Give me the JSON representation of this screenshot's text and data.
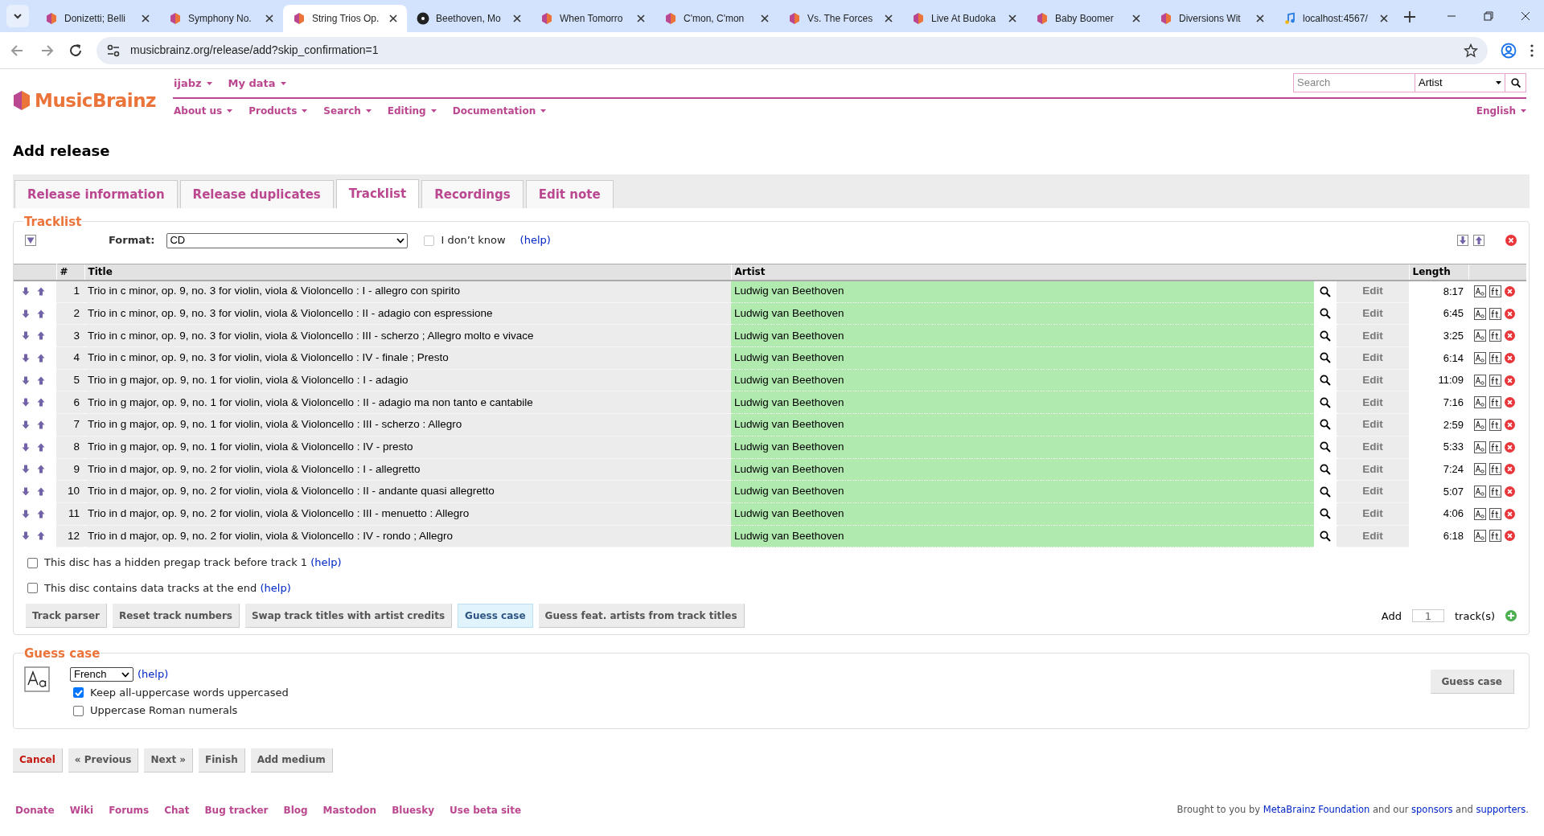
{
  "browser": {
    "tabs": [
      {
        "title": "Donizetti; Belli",
        "kind": "site",
        "selected": false
      },
      {
        "title": "Symphony No.",
        "kind": "site",
        "selected": false
      },
      {
        "title": "String Trios Op.",
        "kind": "site",
        "selected": true
      },
      {
        "title": "Beethoven, Mo",
        "kind": "disc",
        "selected": false
      },
      {
        "title": "When Tomorro",
        "kind": "site",
        "selected": false
      },
      {
        "title": "C'mon, C'mon",
        "kind": "site",
        "selected": false
      },
      {
        "title": "Vs. The Forces",
        "kind": "site",
        "selected": false
      },
      {
        "title": "Live At Budoka",
        "kind": "site",
        "selected": false
      },
      {
        "title": "Baby Boomer",
        "kind": "site",
        "selected": false
      },
      {
        "title": "Diversions Wit",
        "kind": "site",
        "selected": false
      },
      {
        "title": "localhost:4567/",
        "kind": "local",
        "selected": false
      }
    ],
    "url": "musicbrainz.org/release/add?skip_confirmation=1"
  },
  "header": {
    "logo": "MusicBrainz",
    "user_menu": [
      "ijabz",
      "My data"
    ],
    "nav": [
      "About us",
      "Products",
      "Search",
      "Editing",
      "Documentation"
    ],
    "search_placeholder": "Search",
    "search_type": "Artist",
    "language": "English"
  },
  "page_title": "Add release",
  "tabs": [
    {
      "label": "Release information",
      "selected": false
    },
    {
      "label": "Release duplicates",
      "selected": false
    },
    {
      "label": "Tracklist",
      "selected": true
    },
    {
      "label": "Recordings",
      "selected": false
    },
    {
      "label": "Edit note",
      "selected": false
    }
  ],
  "tracklist": {
    "legend": "Tracklist",
    "format_label": "Format:",
    "format": "CD",
    "dont_know": {
      "label": "I don’t know",
      "checked": false
    },
    "help": "(help)",
    "columns": [
      "#",
      "Title",
      "Artist",
      "Length"
    ],
    "tracks": [
      {
        "number": "1",
        "title": "Trio in c minor, op. 9, no. 3 for violin, viola & Violoncello : I - allegro con spirito",
        "artist": "Ludwig van Beethoven",
        "edit": "Edit",
        "length": "8:17"
      },
      {
        "number": "2",
        "title": "Trio in c minor, op. 9, no. 3 for violin, viola & Violoncello : II - adagio con espressione",
        "artist": "Ludwig van Beethoven",
        "edit": "Edit",
        "length": "6:45"
      },
      {
        "number": "3",
        "title": "Trio in c minor, op. 9, no. 3 for violin, viola & Violoncello : III - scherzo ; Allegro molto e vivace",
        "artist": "Ludwig van Beethoven",
        "edit": "Edit",
        "length": "3:25"
      },
      {
        "number": "4",
        "title": "Trio in c minor, op. 9, no. 3 for violin, viola & Violoncello : IV - finale ; Presto",
        "artist": "Ludwig van Beethoven",
        "edit": "Edit",
        "length": "6:14"
      },
      {
        "number": "5",
        "title": "Trio in g major, op. 9, no. 1 for violin, viola & Violoncello : I - adagio",
        "artist": "Ludwig van Beethoven",
        "edit": "Edit",
        "length": "11:09"
      },
      {
        "number": "6",
        "title": "Trio in g major, op. 9, no. 1 for violin, viola & Violoncello : II - adagio ma non tanto e cantabile",
        "artist": "Ludwig van Beethoven",
        "edit": "Edit",
        "length": "7:16"
      },
      {
        "number": "7",
        "title": "Trio in g major, op. 9, no. 1 for violin, viola & Violoncello : III - scherzo : Allegro",
        "artist": "Ludwig van Beethoven",
        "edit": "Edit",
        "length": "2:59"
      },
      {
        "number": "8",
        "title": "Trio in g major, op. 9, no. 1 for violin, viola & Violoncello : IV - presto",
        "artist": "Ludwig van Beethoven",
        "edit": "Edit",
        "length": "5:33"
      },
      {
        "number": "9",
        "title": "Trio in d major, op. 9, no. 2 for violin, viola & Violoncello : I - allegretto",
        "artist": "Ludwig van Beethoven",
        "edit": "Edit",
        "length": "7:24"
      },
      {
        "number": "10",
        "title": "Trio in d major, op. 9, no. 2 for violin, viola & Violoncello : II - andante quasi allegretto",
        "artist": "Ludwig van Beethoven",
        "edit": "Edit",
        "length": "5:07"
      },
      {
        "number": "11",
        "title": "Trio in d major, op. 9, no. 2 for violin, viola & Violoncello : III - menuetto : Allegro",
        "artist": "Ludwig van Beethoven",
        "edit": "Edit",
        "length": "4:06"
      },
      {
        "number": "12",
        "title": "Trio in d major, op. 9, no. 2 for violin, viola & Violoncello : IV - rondo ; Allegro",
        "artist": "Ludwig van Beethoven",
        "edit": "Edit",
        "length": "6:18"
      }
    ],
    "options": [
      {
        "label": "This disc has a hidden pregap track before track 1",
        "help": "(help)",
        "checked": false
      },
      {
        "label": "This disc contains data tracks at the end",
        "help": "(help)",
        "checked": false
      }
    ],
    "tools": [
      {
        "label": "Track parser",
        "highlighted": false
      },
      {
        "label": "Reset track numbers",
        "highlighted": false
      },
      {
        "label": "Swap track titles with artist credits",
        "highlighted": false
      },
      {
        "label": "Guess case",
        "highlighted": true
      },
      {
        "label": "Guess feat. artists from track titles",
        "highlighted": false
      }
    ],
    "add": {
      "label": "Add",
      "count": "1",
      "suffix": "track(s)"
    }
  },
  "guess_case": {
    "legend": "Guess case",
    "language": "French",
    "help": "(help)",
    "options": [
      {
        "label": "Keep all-uppercase words uppercased",
        "checked": true
      },
      {
        "label": "Uppercase Roman numerals",
        "checked": false
      }
    ],
    "button": "Guess case"
  },
  "actions": [
    {
      "label": "Cancel",
      "kind": "cancel"
    },
    {
      "label": "« Previous",
      "kind": "normal"
    },
    {
      "label": "Next »",
      "kind": "normal"
    },
    {
      "label": "Finish",
      "kind": "normal"
    },
    {
      "label": "Add medium",
      "kind": "normal"
    }
  ],
  "footer": {
    "links": [
      "Donate",
      "Wiki",
      "Forums",
      "Chat",
      "Bug tracker",
      "Blog",
      "Mastodon",
      "Bluesky",
      "Use beta site"
    ],
    "credit": [
      "Brought to you by ",
      "MetaBrainz Foundation",
      " and our ",
      "sponsors",
      " and ",
      "supporters",
      "."
    ]
  }
}
